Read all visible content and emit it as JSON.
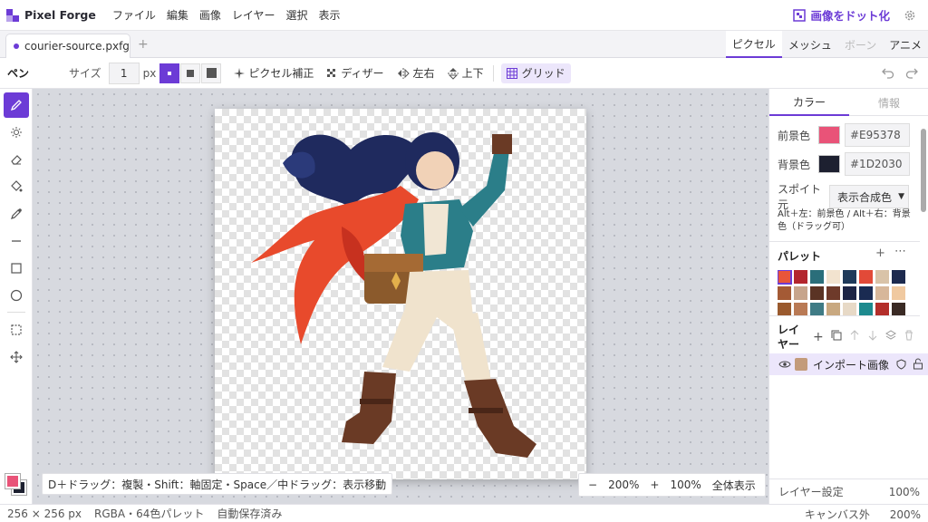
{
  "app": {
    "title": "Pixel Forge"
  },
  "menu": [
    "ファイル",
    "編集",
    "画像",
    "レイヤー",
    "選択",
    "表示"
  ],
  "convert_button": "画像をドット化",
  "document": {
    "tab_name": "courier-source.pxfg",
    "new_tab": "+"
  },
  "mode_tabs": [
    {
      "label": "ピクセル",
      "state": "active"
    },
    {
      "label": "メッシュ",
      "state": "normal"
    },
    {
      "label": "ボーン",
      "state": "disabled"
    },
    {
      "label": "アニメ",
      "state": "normal"
    }
  ],
  "toolbar": {
    "tool_name": "ペン",
    "size_label": "サイズ",
    "size_value": "1",
    "size_unit": "px",
    "pixel_correct": "ピクセル補正",
    "dither": "ディザー",
    "flip_h": "左右",
    "flip_v": "上下",
    "grid": "グリッド"
  },
  "tools": [
    "pencil-tool-icon",
    "brightness-tool-icon",
    "eraser-tool-icon",
    "fill-bucket-tool-icon",
    "eyedropper-tool-icon",
    "line-tool-icon",
    "rectangle-tool-icon",
    "ellipse-tool-icon",
    "marquee-select-tool-icon",
    "move-tool-icon"
  ],
  "colors": {
    "foreground": "#E95378",
    "background": "#1D2030",
    "accent": "#6c3bd6"
  },
  "canvas": {
    "hint": "D＋ドラッグ：複製・Shift：軸固定・Space／中ドラッグ：表示移動",
    "zoom_minus": "−",
    "zoom_level": "200%",
    "zoom_plus": "+",
    "zoom_100": "100%",
    "zoom_fit": "全体表示"
  },
  "panel": {
    "tabs": [
      "カラー",
      "情報"
    ],
    "fg_label": "前景色",
    "fg_hex": "#E95378",
    "bg_label": "背景色",
    "bg_hex": "#1D2030",
    "eyedrop_label": "スポイト元",
    "eyedrop_value": "表示合成色",
    "alt_hint": "Alt＋左：前景色 / Alt＋右：背景色（ドラッグ可）",
    "palette_title": "パレット",
    "palette": [
      "#e8553b",
      "#b3262e",
      "#2a6e7a",
      "#f2e3cf",
      "#1f3a5a",
      "#e24a38",
      "#d9c3a8",
      "#1d2a4e",
      "#a45a35",
      "#c7a58c",
      "#5a3324",
      "#6e3a2a",
      "#1d2545",
      "#1a2b52",
      "#d7b79a",
      "#f0c9a0",
      "#9a5a2e",
      "#b97a55",
      "#3f7b85",
      "#c8a880",
      "#e7d9c6",
      "#1e8a8e",
      "#b32e2a",
      "#3a2a24"
    ],
    "palette_selected": 0,
    "layers_title": "レイヤー",
    "layer_name": "インポート画像",
    "layer_settings_label": "レイヤー設定",
    "layer_opacity": "100%"
  },
  "status": {
    "dimensions": "256 × 256 px",
    "mode": "RGBA・64色パレット",
    "save": "自動保存済み",
    "canvas_label": "キャンバス外",
    "zoom": "200%"
  }
}
